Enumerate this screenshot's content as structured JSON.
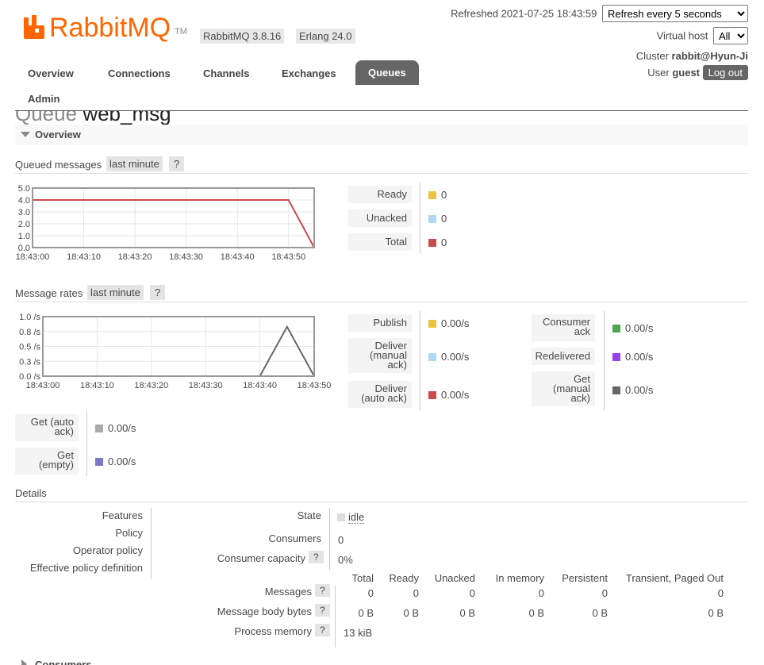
{
  "header": {
    "logo_text": "RabbitMQ",
    "logo_tm": "TM",
    "version_rabbitmq": "RabbitMQ 3.8.16",
    "version_erlang": "Erlang 24.0",
    "refreshed_label": "Refreshed 2021-07-25 18:43:59",
    "refresh_select": "Refresh every 5 seconds",
    "virtual_host_label": "Virtual host",
    "virtual_host_select": "All",
    "cluster_label": "Cluster",
    "cluster_name": "rabbit@Hyun-Ji",
    "user_label": "User",
    "user_name": "guest",
    "logout_label": "Log out"
  },
  "nav": {
    "tabs": [
      "Overview",
      "Connections",
      "Channels",
      "Exchanges",
      "Queues",
      "Admin"
    ],
    "active": "Queues"
  },
  "page": {
    "title_prefix": "Queue",
    "title_name": "web_msg",
    "section_overview": "Overview"
  },
  "queued_messages": {
    "title": "Queued messages",
    "range": "last minute",
    "help": "?",
    "legend": [
      {
        "label": "Ready",
        "value": "0",
        "color": "#edc240"
      },
      {
        "label": "Unacked",
        "value": "0",
        "color": "#afd8f8"
      },
      {
        "label": "Total",
        "value": "0",
        "color": "#cb4b4b"
      }
    ]
  },
  "message_rates": {
    "title": "Message rates",
    "range": "last minute",
    "help": "?",
    "legend_left": [
      {
        "label": "Publish",
        "value": "0.00/s",
        "color": "#edc240"
      },
      {
        "label": "Deliver (manual ack)",
        "value": "0.00/s",
        "color": "#afd8f8"
      },
      {
        "label": "Deliver (auto ack)",
        "value": "0.00/s",
        "color": "#cb4b4b"
      }
    ],
    "legend_right": [
      {
        "label": "Consumer ack",
        "value": "0.00/s",
        "color": "#4da74d"
      },
      {
        "label": "Redelivered",
        "value": "0.00/s",
        "color": "#9440ed"
      },
      {
        "label": "Get (manual ack)",
        "value": "0.00/s",
        "color": "#666666"
      }
    ],
    "legend_bottom": [
      {
        "label": "Get (auto ack)",
        "value": "0.00/s",
        "color": "#aaaaaa"
      },
      {
        "label": "Get (empty)",
        "value": "0.00/s",
        "color": "#7a7ac4"
      }
    ]
  },
  "chart_data": [
    {
      "type": "line",
      "x": [
        "18:43:00",
        "18:43:10",
        "18:43:20",
        "18:43:30",
        "18:43:40",
        "18:43:50",
        "18:43:55"
      ],
      "series": [
        {
          "name": "Total",
          "color": "#cb4b4b",
          "values": [
            4,
            4,
            4,
            4,
            4,
            4,
            0
          ]
        },
        {
          "name": "Unacked",
          "color": "#afd8f8",
          "values": [
            0,
            0,
            0,
            0,
            0,
            0,
            0
          ]
        }
      ],
      "ylim": [
        0,
        5
      ],
      "yticks": [
        "5.0",
        "4.0",
        "3.0",
        "2.0",
        "1.0",
        "0.0"
      ],
      "xticks": [
        "18:43:00",
        "18:43:10",
        "18:43:20",
        "18:43:30",
        "18:43:40",
        "18:43:50"
      ],
      "grid": true
    },
    {
      "type": "line",
      "x": [
        "18:43:00",
        "18:43:10",
        "18:43:20",
        "18:43:30",
        "18:43:40",
        "18:43:45",
        "18:43:50"
      ],
      "series": [
        {
          "name": "Get (manual ack)",
          "color": "#666666",
          "values": [
            0,
            0,
            0,
            0,
            0,
            0.83,
            0
          ]
        },
        {
          "name": "Get (empty)",
          "color": "#7a7ac4",
          "values": [
            0,
            0,
            0,
            0,
            0,
            0,
            0
          ]
        }
      ],
      "ylim": [
        0,
        1
      ],
      "yticks": [
        "1.0 /s",
        "0.8 /s",
        "0.5 /s",
        "0.3 /s",
        "0.0 /s"
      ],
      "xticks": [
        "18:43:00",
        "18:43:10",
        "18:43:20",
        "18:43:30",
        "18:43:40",
        "18:43:50"
      ],
      "grid": true
    }
  ],
  "details": {
    "title": "Details",
    "left_labels": [
      "Features",
      "Policy",
      "Operator policy",
      "Effective policy definition"
    ],
    "state_label": "State",
    "state_value": "idle",
    "consumers_label": "Consumers",
    "consumers_value": "0",
    "capacity_label": "Consumer capacity",
    "capacity_value": "0%",
    "help": "?",
    "table": {
      "columns": [
        "Total",
        "Ready",
        "Unacked",
        "In memory",
        "Persistent",
        "Transient, Paged Out"
      ],
      "rows": [
        {
          "label": "Messages",
          "values": [
            "0",
            "0",
            "0",
            "0",
            "0",
            "0"
          ]
        },
        {
          "label": "Message body bytes",
          "values": [
            "0 B",
            "0 B",
            "0 B",
            "0 B",
            "0 B",
            "0 B"
          ]
        },
        {
          "label": "Process memory",
          "values": [
            "13 kiB"
          ]
        }
      ]
    }
  },
  "next_section": "Consumers"
}
